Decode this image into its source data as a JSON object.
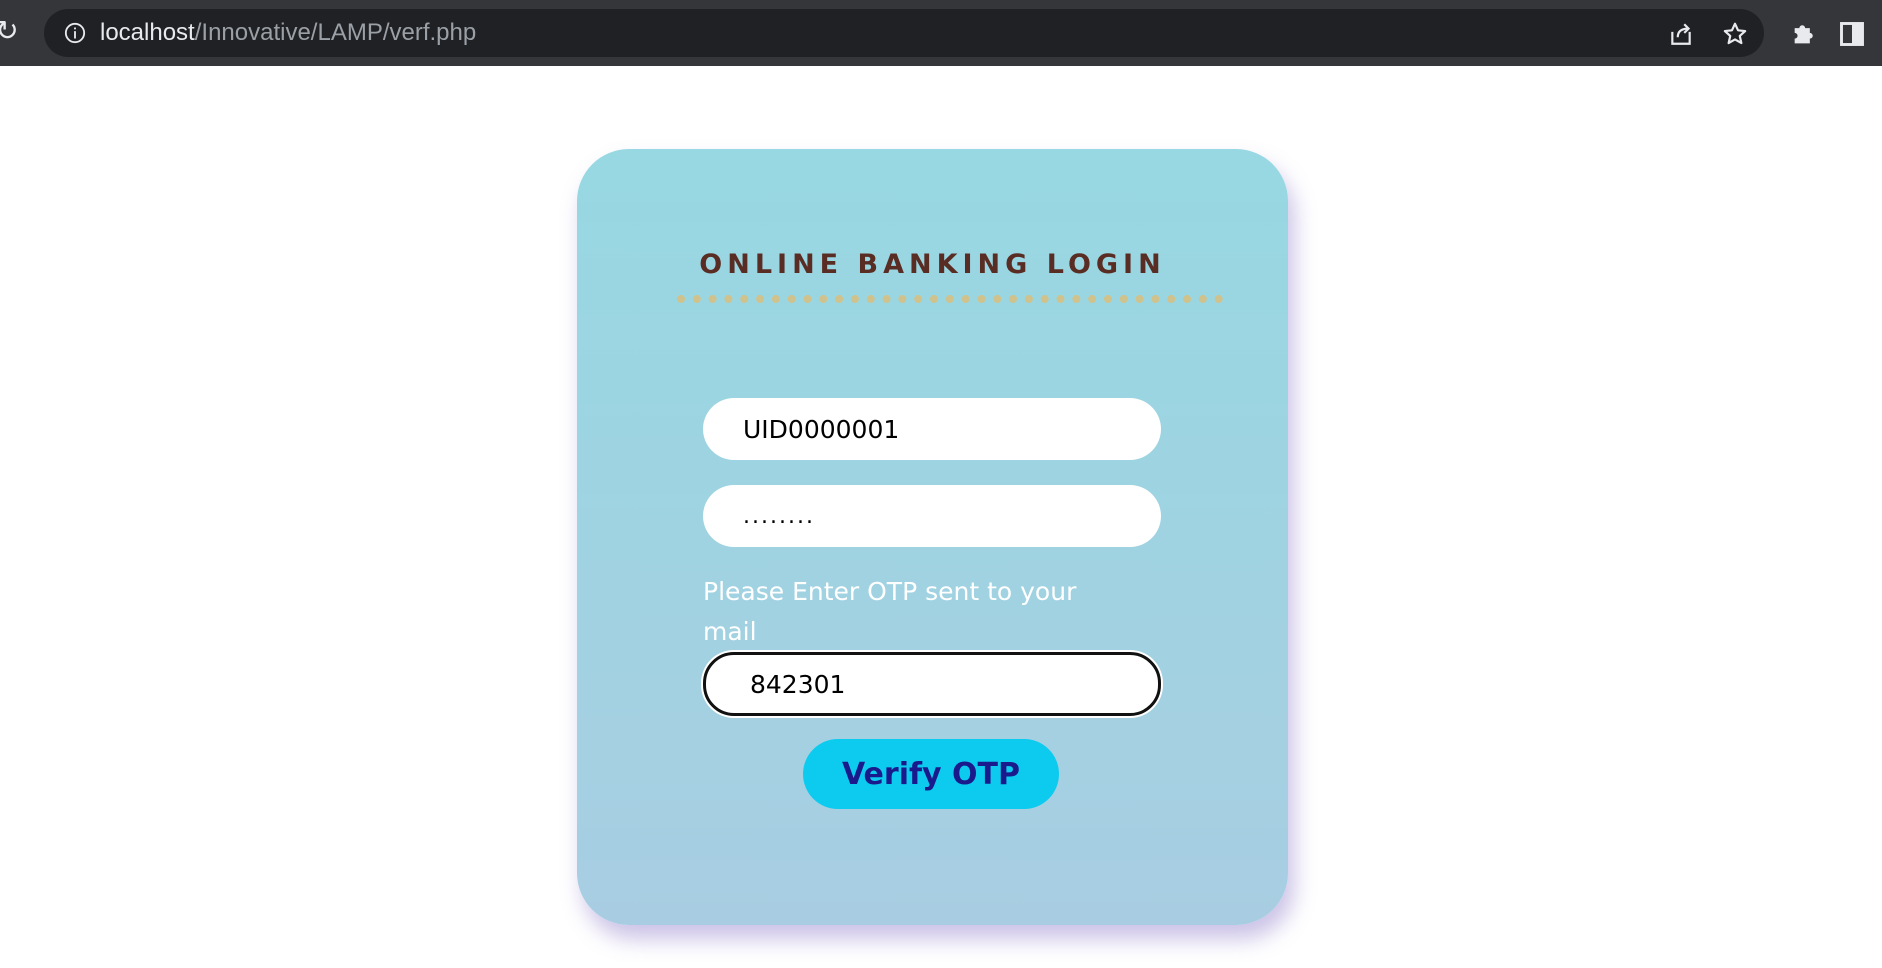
{
  "browser": {
    "url_host": "localhost",
    "url_path": "/Innovative/LAMP/verf.php"
  },
  "login": {
    "title": "ONLINE BANKING LOGIN",
    "user_id_value": "UID0000001",
    "password_value": "........",
    "otp_label": "Please Enter OTP sent to your mail",
    "otp_value": "842301",
    "verify_label": "Verify OTP"
  },
  "colors": {
    "card_background": "#9ad6e2",
    "title_color": "#5a2d24",
    "button_background": "#0ccbef",
    "button_text": "#1a1a8c",
    "browser_bar": "#35363a"
  }
}
